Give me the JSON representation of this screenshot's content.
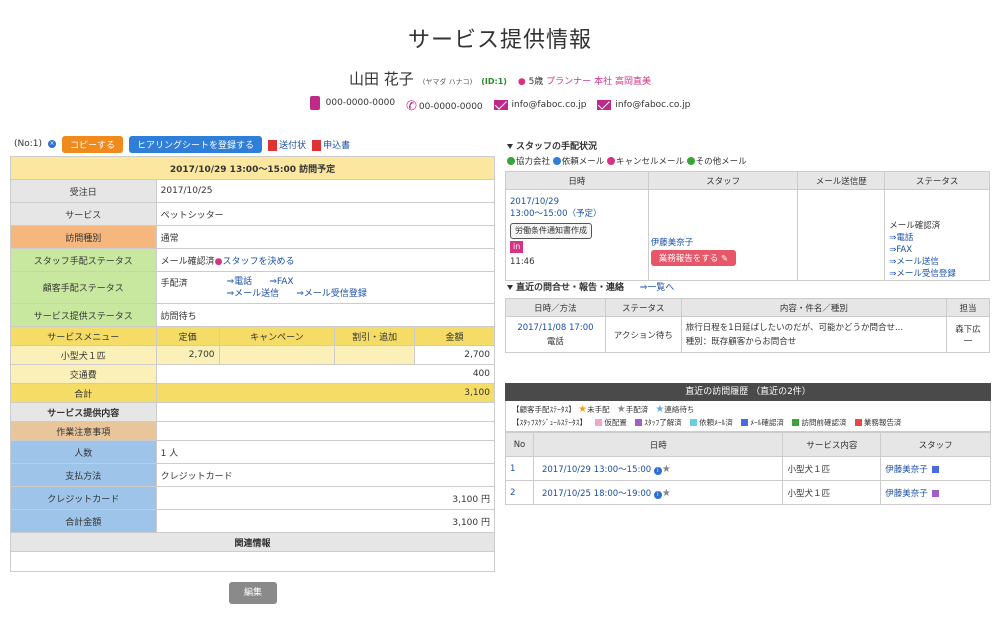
{
  "title": "サービス提供情報",
  "client": {
    "name": "山田 花子",
    "kana": "(ヤマダ ハナコ)",
    "id": "(ID:1)",
    "age": "5歳",
    "planner_label": "プランナー",
    "branch": "本社",
    "planner_name": "高岡直美",
    "mobile": "000-0000-0000",
    "tel": "00-0000-0000",
    "email1": "info@faboc.co.jp",
    "email2": "info@faboc.co.jp"
  },
  "toolbar": {
    "no": "(No:1)",
    "copy": "コピーする",
    "hearing": "ヒアリングシートを登録する",
    "sendsheet": "送付状",
    "application": "申込書"
  },
  "main": {
    "header": "2017/10/29 13:00～15:00  訪問予定",
    "order_date_label": "受注日",
    "order_date": "2017/10/25",
    "service_label": "サービス",
    "service": "ペットシッター",
    "visit_type_label": "訪問種別",
    "visit_type": "通常",
    "staff_status_label": "スタッフ手配ステータス",
    "staff_status": "メール確認済",
    "staff_decide": "スタッフを決める",
    "client_status_label": "顧客手配ステータス",
    "client_status": "手配済",
    "phone_link": "⇒電話",
    "fax_link": "⇒FAX",
    "mail_send": "⇒メール送信",
    "mail_recv": "⇒メール受信登録",
    "provide_status_label": "サービス提供ステータス",
    "provide_status": "訪問待ち",
    "menu_cols": [
      "サービスメニュー",
      "定価",
      "キャンペーン",
      "割引・追加",
      "金額"
    ],
    "menu_row": [
      "小型犬１匹",
      "2,700",
      "",
      "",
      "2,700"
    ],
    "transport_label": "交通費",
    "transport": "400",
    "total_label": "合計",
    "total": "3,100",
    "content_label": "サービス提供内容",
    "notes_label": "作業注意事項",
    "people_label": "人数",
    "people": "1 人",
    "payment_label": "支払方法",
    "payment": "クレジットカード",
    "credit_label": "クレジットカード",
    "credit": "3,100 円",
    "grand_label": "合計金額",
    "grand": "3,100 円",
    "related_label": "関連情報",
    "edit": "編集"
  },
  "staff_section": {
    "title": "スタッフの手配状況",
    "legend": [
      "協力会社",
      "依頼メール",
      "キャンセルメール",
      "その他メール"
    ],
    "legend_colors": [
      "#3aa33a",
      "#2f7ed8",
      "#d63384",
      "#3aa33a"
    ],
    "cols": [
      "日時",
      "スタッフ",
      "メール送信歴",
      "ステータス"
    ],
    "date": "2017/10/29",
    "time": "13:00～15:00（予定）",
    "doc_tag": "労働条件通知書作成",
    "in_tag": "in",
    "in_time": "11:46",
    "staff": "伊藤美奈子",
    "report_btn": "業務報告をする",
    "status": "メール確認済",
    "links": [
      "⇒電話",
      "⇒FAX",
      "⇒メール送信",
      "⇒メール受信登録"
    ]
  },
  "inquiry_section": {
    "title": "直近の問合せ・報告・連絡",
    "list_link": "⇒一覧へ",
    "cols": [
      "日時／方法",
      "ステータス",
      "内容・件名／種別",
      "担当"
    ],
    "datetime": "2017/11/08 17:00",
    "method": "電話",
    "status": "アクション待ち",
    "content": "旅行日程を1日延ばしたいのだが、可能かどうか問合せ...",
    "kind": "種別：既存顧客からお問合せ",
    "person": "森下広一"
  },
  "visit_section": {
    "title": "直近の訪問履歴  （直近の2件）",
    "legend1_label": "【顧客手配ｽﾃｰﾀｽ】",
    "legend1": [
      {
        "label": "未手配",
        "color": "#f0a020"
      },
      {
        "label": "手配済",
        "color": "#888888"
      },
      {
        "label": "連絡待ち",
        "color": "#6aa8e0"
      }
    ],
    "legend2_label": "【ｽﾀｯﾌｽｹｼﾞｭｰﾙｽﾃｰﾀｽ】",
    "legend2": [
      {
        "label": "仮配置",
        "color": "#f4a6c8"
      },
      {
        "label": "ｽﾀｯﾌ了解済",
        "color": "#a060c8"
      },
      {
        "label": "依頼ﾒｰﾙ済",
        "color": "#6ad0e0"
      },
      {
        "label": "ﾒｰﾙ確認済",
        "color": "#4a6ae0"
      },
      {
        "label": "訪問前確認済",
        "color": "#3aa33a"
      },
      {
        "label": "業務報告済",
        "color": "#e04a4a"
      }
    ],
    "cols": [
      "No",
      "日時",
      "サービス内容",
      "スタッフ"
    ],
    "rows": [
      {
        "no": "1",
        "datetime": "2017/10/29  13:00～15:00",
        "service": "小型犬１匹",
        "staff": "伊藤美奈子",
        "color": "#4a6ae0"
      },
      {
        "no": "2",
        "datetime": "2017/10/25  18:00～19:00",
        "service": "小型犬１匹",
        "staff": "伊藤美奈子",
        "color": "#a060c8"
      }
    ]
  }
}
